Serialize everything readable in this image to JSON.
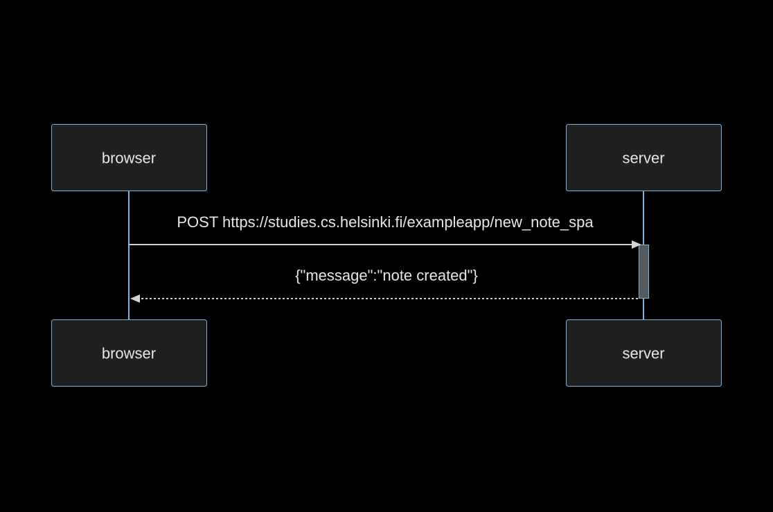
{
  "participants": {
    "browser": "browser",
    "server": "server"
  },
  "messages": [
    {
      "text": "POST https://studies.cs.helsinki.fi/exampleapp/new_note_spa",
      "from": "browser",
      "to": "server",
      "style": "solid"
    },
    {
      "text": "{\"message\":\"note created\"}",
      "from": "server",
      "to": "browser",
      "style": "dashed"
    }
  ],
  "colors": {
    "background": "#000000",
    "actor_fill": "#1f2020",
    "actor_border": "#81b1db",
    "lifeline": "#81b1db",
    "message_line": "#d3d3d3",
    "text": "#e6e6e6",
    "activation_fill": "#555a5c"
  }
}
